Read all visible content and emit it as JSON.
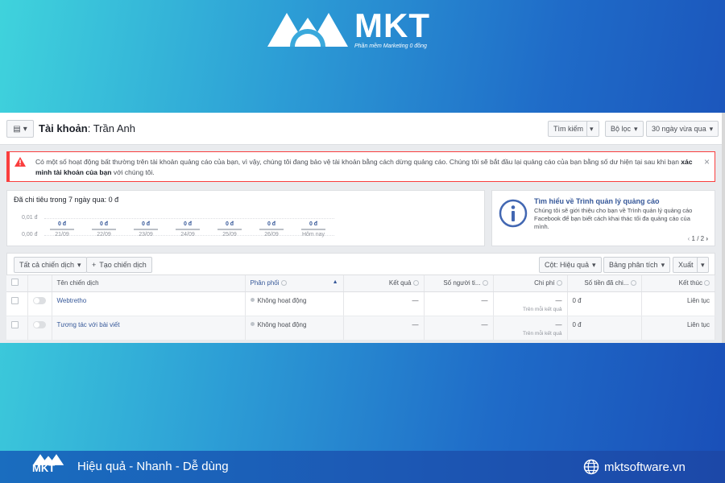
{
  "brand": {
    "name": "MKT",
    "tagline": "Phần mềm Marketing 0 đồng",
    "slogan": "Hiệu quả - Nhanh - Dễ dùng",
    "website": "mktsoftware.vn"
  },
  "account": {
    "label": "Tài khoản",
    "name": "Trần Anh"
  },
  "topbar": {
    "search": "Tìm kiếm",
    "filter": "Bộ lọc",
    "date_range": "30 ngày vừa qua"
  },
  "alert": {
    "text_part1": "Có một số hoạt động bất thường trên tài khoản quảng cáo của bạn, vì vậy, chúng tôi đang bảo vệ tài khoản bằng cách dừng quảng cáo. Chúng tôi sẽ bắt đầu lại quảng cáo của bạn bằng số dư hiện tại sau khi bạn",
    "link_text": "xác minh tài khoản của bạn",
    "text_part2": "với chúng tôi."
  },
  "spend": {
    "title": "Đã chi tiêu trong 7 ngày qua: 0 đ",
    "y_top": "0,01 đ",
    "y_bottom": "0,00 đ",
    "days": [
      {
        "value": "0 đ",
        "date": "21/09"
      },
      {
        "value": "0 đ",
        "date": "22/09"
      },
      {
        "value": "0 đ",
        "date": "23/09"
      },
      {
        "value": "0 đ",
        "date": "24/09"
      },
      {
        "value": "0 đ",
        "date": "25/09"
      },
      {
        "value": "0 đ",
        "date": "26/09"
      },
      {
        "value": "0 đ",
        "date": "Hôm nay"
      }
    ]
  },
  "info_card": {
    "title": "Tìm hiểu về Trình quản lý quảng cáo",
    "body": "Chúng tôi sẽ giới thiệu cho bạn về Trình quản lý quảng cáo Facebook để bạn biết cách khai thác tối đa quảng cáo của mình.",
    "page": "1 / 2"
  },
  "toolbar": {
    "all_campaigns": "Tất cả chiến dịch",
    "create": "Tạo chiến dịch",
    "columns": "Cột: Hiệu quả",
    "breakdown": "Bảng phân tích",
    "export": "Xuất"
  },
  "table": {
    "headers": [
      "Tên chiến dịch",
      "Phân phối",
      "Kết quả",
      "Số người ti...",
      "Chi phí",
      "Số tiền đã chi...",
      "Kết thúc"
    ],
    "rows": [
      {
        "name": "Webtretho",
        "delivery": "Không hoạt động",
        "results": "—",
        "reach": "—",
        "cost": "—",
        "cost_sub": "Trên mỗi kết quả",
        "spent": "0 đ",
        "ends": "Liên tục"
      },
      {
        "name": "Tương tác với bài viết",
        "delivery": "Không hoạt động",
        "results": "—",
        "reach": "—",
        "cost": "—",
        "cost_sub": "Trên mỗi kết quả",
        "spent": "0 đ",
        "ends": "Liên tục"
      }
    ]
  }
}
